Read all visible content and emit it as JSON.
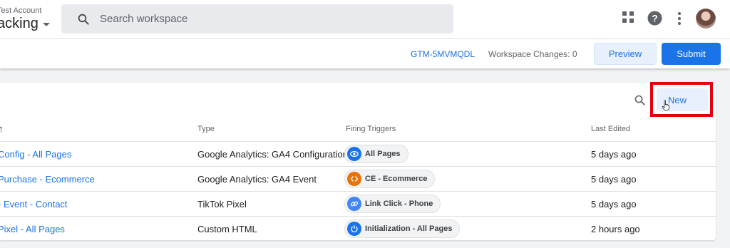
{
  "header": {
    "account_label": "Test Account",
    "container_name": "acking",
    "search_placeholder": "Search workspace"
  },
  "toolbar": {
    "container_id": "GTM-5MVMQDL",
    "workspace_changes": "Workspace Changes: 0",
    "preview_label": "Preview",
    "submit_label": "Submit"
  },
  "table": {
    "new_label": "New",
    "columns": {
      "name_sort": "↑",
      "type": "Type",
      "triggers": "Firing Triggers",
      "edited": "Last Edited"
    },
    "rows": [
      {
        "name": "Config - All Pages",
        "type": "Google Analytics: GA4 Configuration",
        "trigger": "All Pages",
        "trigger_icon": "eye-icon",
        "trigger_color": "#1a73e8",
        "edited": "5 days ago"
      },
      {
        "name": "Purchase - Ecommerce",
        "type": "Google Analytics: GA4 Event",
        "trigger": "CE - Ecommerce",
        "trigger_icon": "code-icon",
        "trigger_color": "#e8710a",
        "edited": "5 days ago"
      },
      {
        "name": "- Event - Contact",
        "type": "TikTok Pixel",
        "trigger": "Link Click - Phone",
        "trigger_icon": "link-icon",
        "trigger_color": "#4285f4",
        "edited": "5 days ago"
      },
      {
        "name": "Pixel - All Pages",
        "type": "Custom HTML",
        "trigger": "Initialization - All Pages",
        "trigger_icon": "power-icon",
        "trigger_color": "#1a73e8",
        "edited": "2 hours ago"
      }
    ]
  },
  "colors": {
    "accent": "#1a73e8",
    "highlight_box": "#e3000f"
  }
}
